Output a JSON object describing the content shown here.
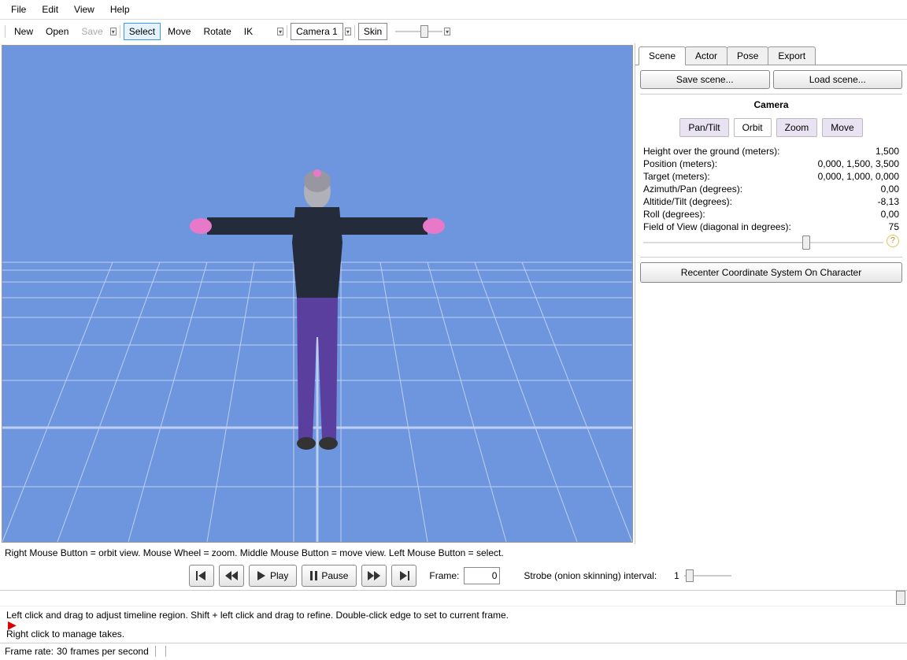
{
  "menu": {
    "file": "File",
    "edit": "Edit",
    "view": "View",
    "help": "Help"
  },
  "toolbar": {
    "new": "New",
    "open": "Open",
    "save": "Save",
    "select": "Select",
    "move": "Move",
    "rotate": "Rotate",
    "ik": "IK",
    "camera": "Camera 1",
    "skin": "Skin"
  },
  "viewport": {
    "hint": "Right Mouse Button = orbit view. Mouse Wheel = zoom. Middle Mouse Button = move view. Left Mouse Button = select."
  },
  "panel": {
    "tabs": {
      "scene": "Scene",
      "actor": "Actor",
      "pose": "Pose",
      "export": "Export"
    },
    "save_scene": "Save scene...",
    "load_scene": "Load scene...",
    "camera_title": "Camera",
    "pan_tilt": "Pan/Tilt",
    "orbit": "Orbit",
    "zoom": "Zoom",
    "move_cam": "Move",
    "props": {
      "height_label": "Height over the ground (meters):",
      "height_val": "1,500",
      "pos_label": "Position (meters):",
      "pos_val": "0,000, 1,500, 3,500",
      "target_label": "Target (meters):",
      "target_val": "0,000, 1,000, 0,000",
      "azimuth_label": "Azimuth/Pan (degrees):",
      "azimuth_val": "0,00",
      "altitude_label": "Altitide/Tilt (degrees):",
      "altitude_val": "-8,13",
      "roll_label": "Roll (degrees):",
      "roll_val": "0,00",
      "fov_label": "Field of View (diagonal in degrees):",
      "fov_val": "75"
    },
    "recenter": "Recenter Coordinate System On Character"
  },
  "playback": {
    "play": "Play",
    "pause": "Pause",
    "frame_label": "Frame:",
    "frame_val": "0",
    "strobe_label": "Strobe (onion skinning) interval:",
    "strobe_val": "1"
  },
  "timeline": {
    "hint": "Left click and drag to adjust timeline region. Shift + left click and drag to refine. Double-click edge to set to current frame.",
    "takes_hint": "Right click to manage takes."
  },
  "status": {
    "framerate_label": "Frame rate:",
    "framerate_val": "30",
    "framerate_unit": "frames per second"
  }
}
